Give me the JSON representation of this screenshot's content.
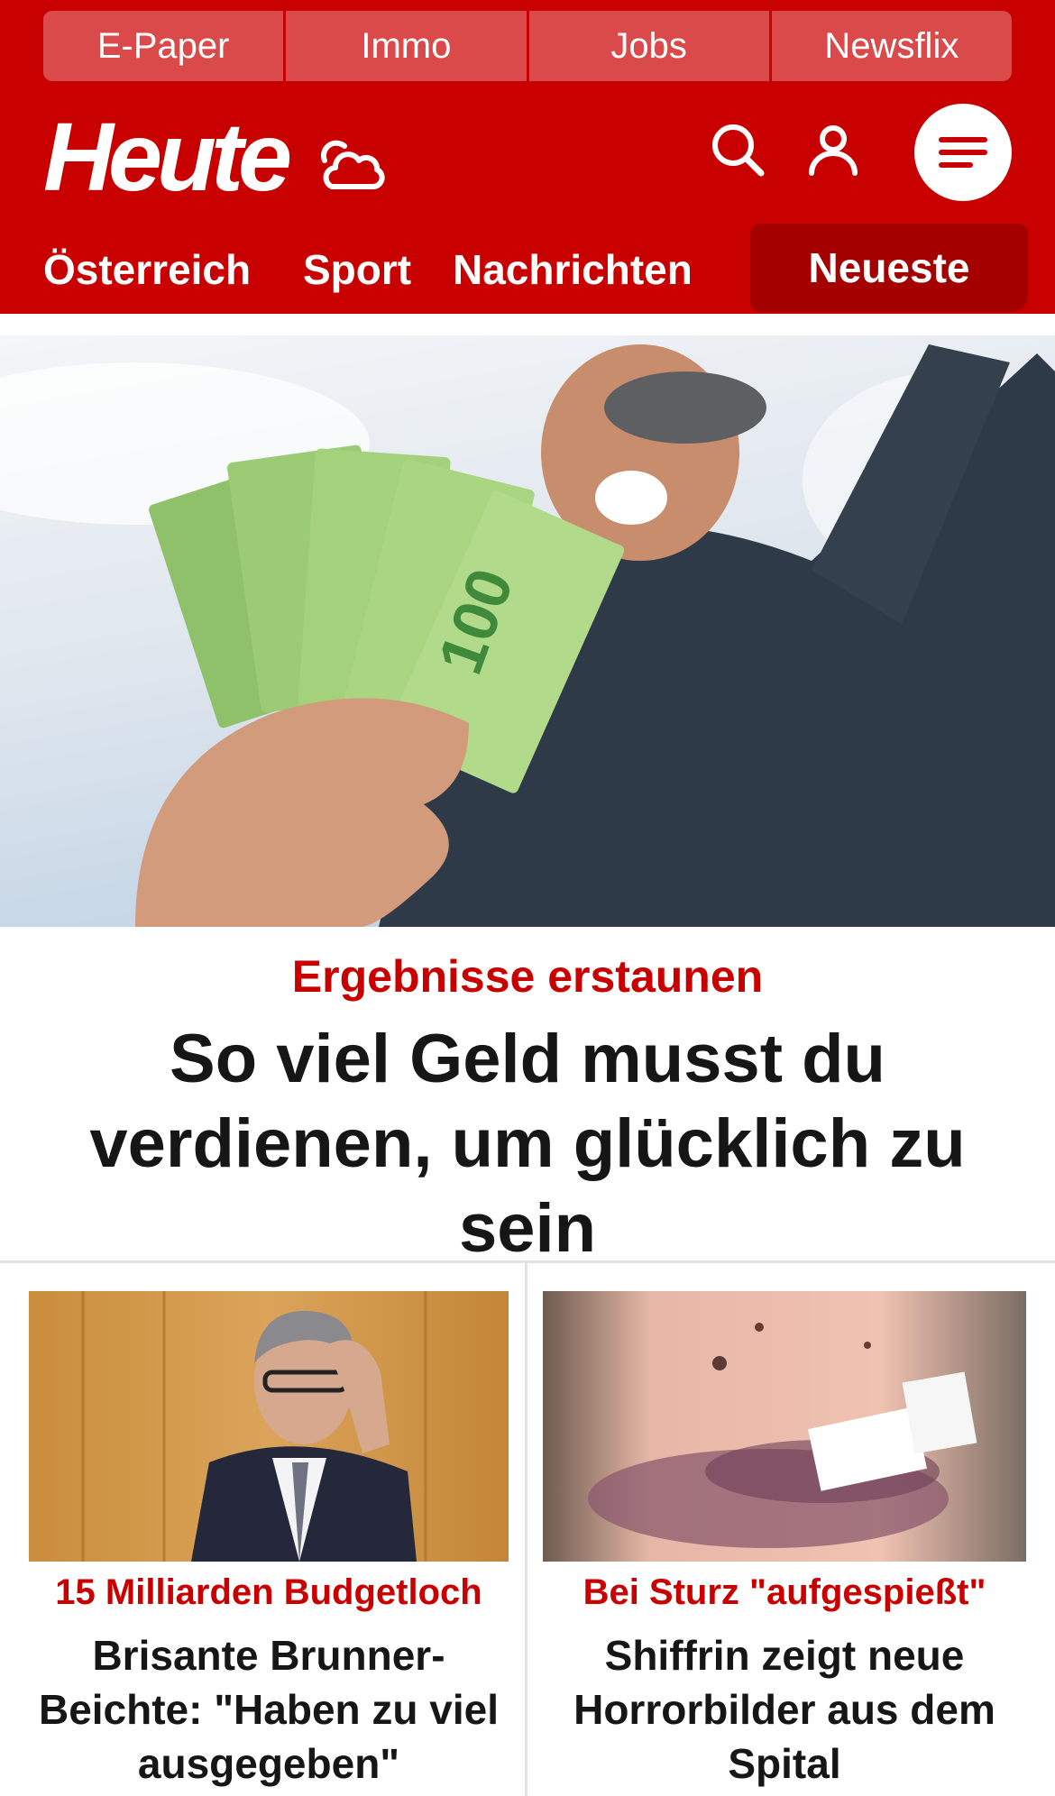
{
  "topbar": {
    "links": [
      "E-Paper",
      "Immo",
      "Jobs",
      "Newsflix"
    ]
  },
  "brand": {
    "logo_text": "Heute",
    "weather_icon": "cloud-sun-icon",
    "accent": "#c80000"
  },
  "header_icons": {
    "search": "search-icon",
    "account": "user-icon",
    "menu": "menu-icon"
  },
  "nav": {
    "items": [
      "Österreich",
      "Sport",
      "Nachrichten"
    ],
    "active": "Neueste"
  },
  "hero": {
    "kicker": "Ergebnisse erstaunen",
    "title": "So viel Geld musst du verdienen, um glücklich zu sein",
    "banknote_text": "100"
  },
  "teasers": [
    {
      "kicker": "15 Milliarden Budgetloch",
      "title": "Brisante Brunner-Beichte: \"Haben zu viel ausgegeben\""
    },
    {
      "kicker": "Bei Sturz \"aufgespießt\"",
      "title": "Shiffrin zeigt neue Horrorbilder aus dem Spital"
    }
  ]
}
